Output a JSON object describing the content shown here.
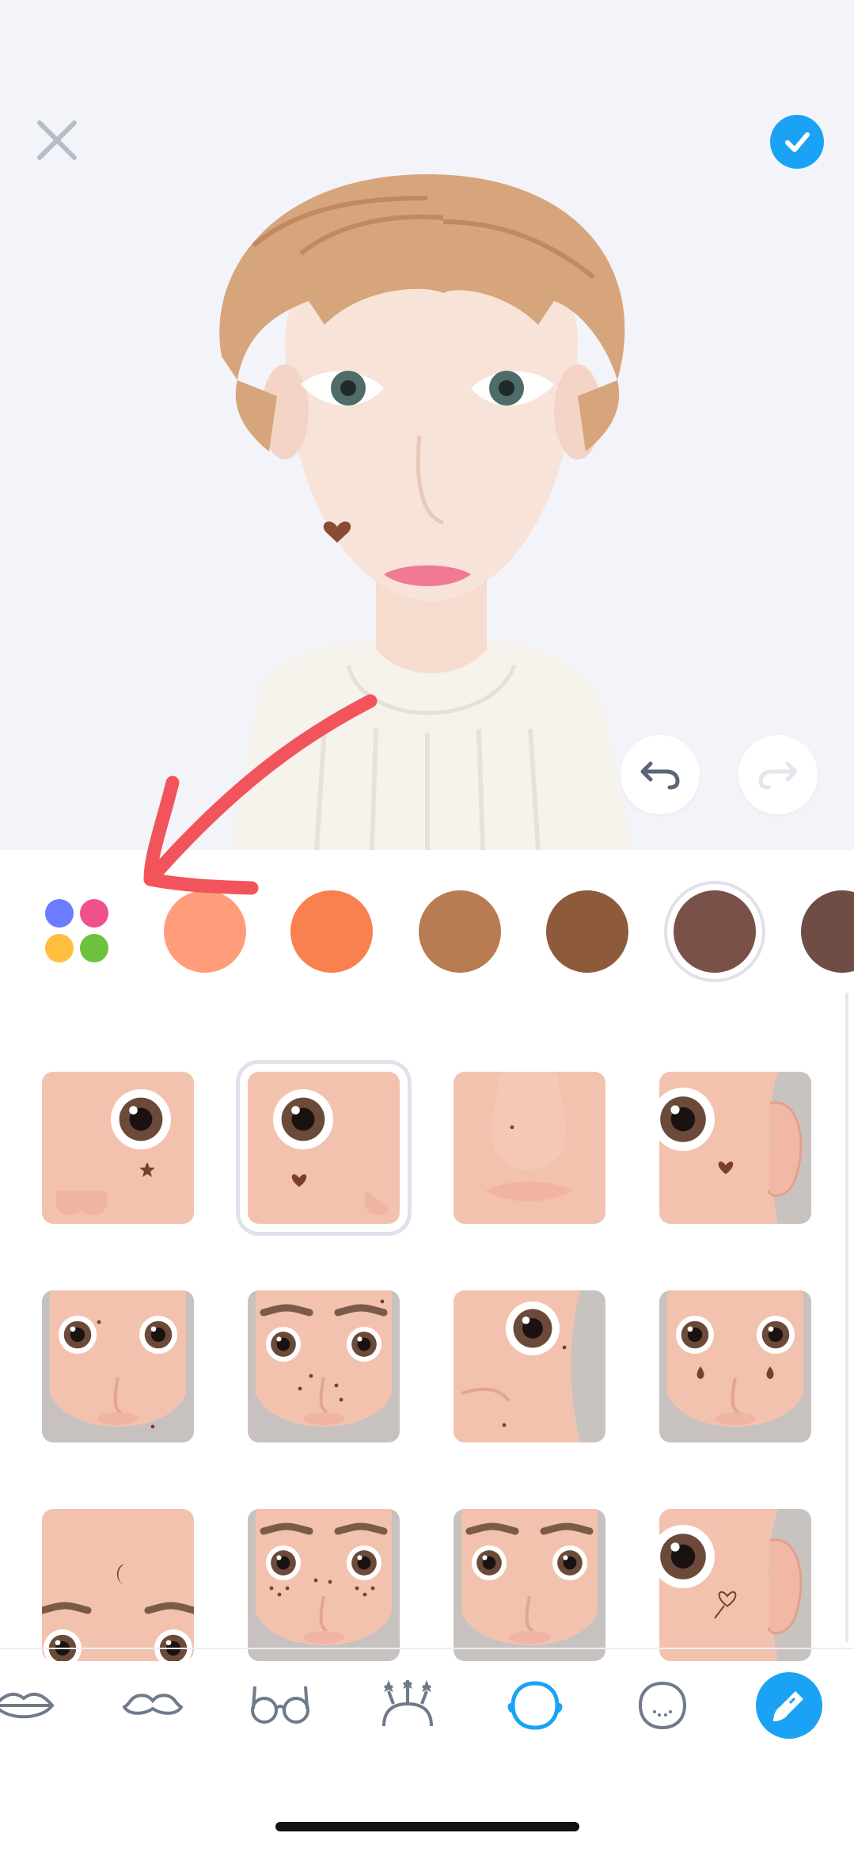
{
  "header": {
    "close_icon": "close-icon",
    "confirm_icon": "checkmark-icon"
  },
  "history": {
    "undo_icon": "undo-icon",
    "redo_icon": "redo-icon"
  },
  "palette": {
    "toggle_colors": [
      "#6b7cff",
      "#f0508c",
      "#ffbe3c",
      "#6cc23a"
    ],
    "swatches": [
      "#ff9d7a",
      "#f9804f",
      "#b97b52",
      "#8d5b3c",
      "#7a5148",
      "#6e4e44"
    ],
    "selected_index": 4
  },
  "stickers": {
    "selected_index": 1,
    "items": [
      {
        "name": "star-mark-under-eye"
      },
      {
        "name": "heart-mark-under-eye"
      },
      {
        "name": "mole-on-nose"
      },
      {
        "name": "spade-mark-near-ear"
      },
      {
        "name": "moles-face"
      },
      {
        "name": "freckle-dots-face"
      },
      {
        "name": "mole-above-lip"
      },
      {
        "name": "teardrop-marks"
      },
      {
        "name": "moon-mark-forehead"
      },
      {
        "name": "freckles-face"
      },
      {
        "name": "plain-face"
      },
      {
        "name": "heart-outline-near-ear"
      }
    ]
  },
  "tabs": [
    {
      "icon": "lips-icon"
    },
    {
      "icon": "mustache-icon"
    },
    {
      "icon": "glasses-icon"
    },
    {
      "icon": "headband-icon"
    },
    {
      "icon": "face-sticker-icon",
      "active": true
    },
    {
      "icon": "face-freckles-icon"
    },
    {
      "icon": "paintbrush-icon"
    }
  ],
  "colors": {
    "accent": "#1aa3f4",
    "annotation_arrow": "#f2545b",
    "skin": "#f3c2ae",
    "mark": "#7a3f2a"
  }
}
